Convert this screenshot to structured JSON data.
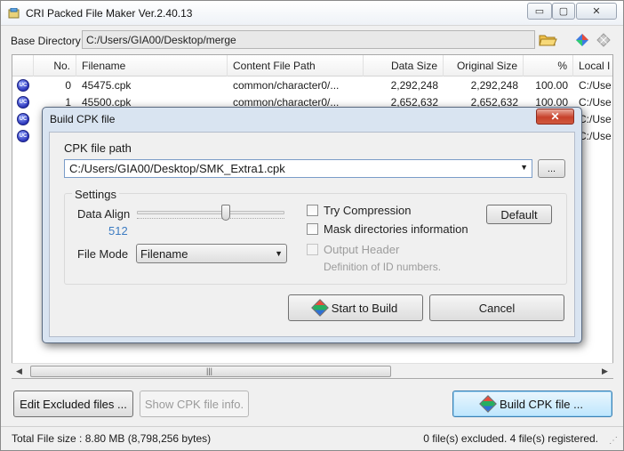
{
  "window": {
    "title": "CRI Packed File Maker Ver.2.40.13",
    "controls": {
      "minimize": "▭",
      "maximize": "▢",
      "close": "✕"
    }
  },
  "base_directory": {
    "label": "Base Directory",
    "value": "C:/Users/GIA00/Desktop/merge"
  },
  "list": {
    "columns": [
      "",
      "No.",
      "Filename",
      "Content File Path",
      "Data Size",
      "Original Size",
      "%",
      "Local I"
    ],
    "rows": [
      {
        "no": "0",
        "filename": "45475.cpk",
        "path": "common/character0/...",
        "data_size": "2,292,248",
        "original_size": "2,292,248",
        "pct": "100.00",
        "local": "C:/Use"
      },
      {
        "no": "1",
        "filename": "45500.cpk",
        "path": "common/character0/...",
        "data_size": "2,652,632",
        "original_size": "2,652,632",
        "pct": "100.00",
        "local": "C:/Use"
      },
      {
        "no": "",
        "filename": "",
        "path": "",
        "data_size": "",
        "original_size": "",
        "pct": "",
        "local": "C:/Use"
      },
      {
        "no": "",
        "filename": "",
        "path": "",
        "data_size": "",
        "original_size": "",
        "pct": "",
        "local": "C:/Use"
      }
    ],
    "hscroll_grip": "|||"
  },
  "buttons": {
    "edit_excluded": "Edit Excluded files ...",
    "show_info": "Show CPK file info.",
    "build": "Build CPK file ..."
  },
  "status": {
    "total": "Total File size : 8.80 MB (8,798,256 bytes)",
    "summary": "0 file(s) excluded.  4 file(s) registered."
  },
  "dialog": {
    "title": "Build CPK file",
    "close": "✕",
    "cpk_path_label": "CPK file path",
    "cpk_path_value": "C:/Users/GIA00/Desktop/SMK_Extra1.cpk",
    "browse": "...",
    "settings_label": "Settings",
    "data_align_label": "Data Align",
    "data_align_value": "512",
    "data_align_level": 0.6,
    "file_mode_label": "File Mode",
    "file_mode_value": "Filename",
    "try_compression": "Try Compression",
    "mask_dirs": "Mask directories information",
    "output_header": "Output Header",
    "output_header_sub": "Definition of ID numbers.",
    "default_btn": "Default",
    "start_btn": "Start to Build",
    "cancel_btn": "Cancel"
  }
}
